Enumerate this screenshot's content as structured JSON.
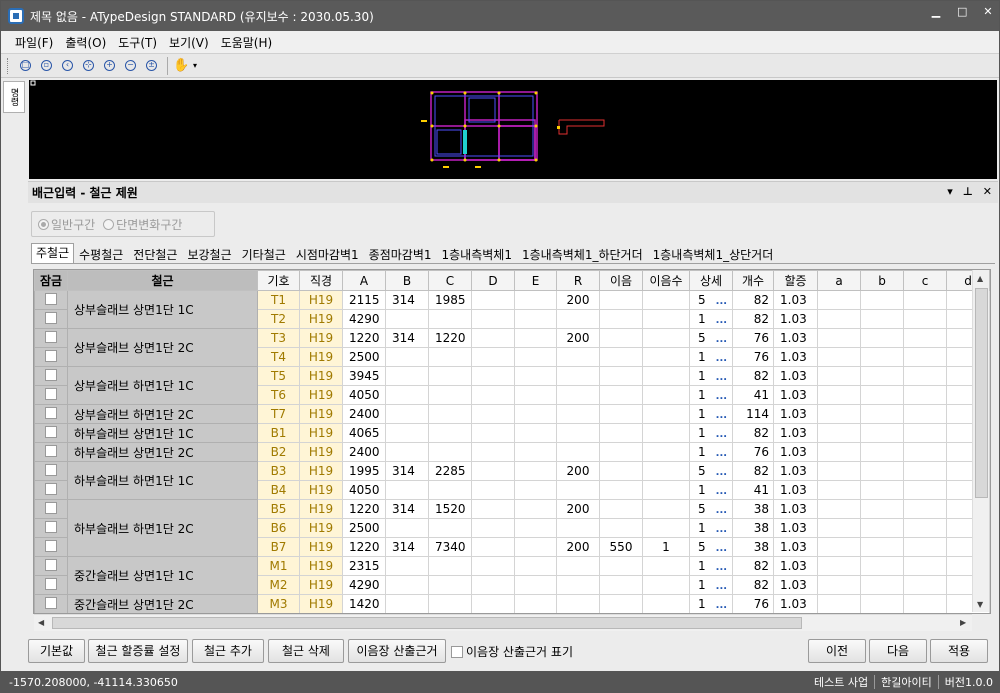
{
  "window": {
    "title": "제목 없음 - ATypeDesign STANDARD  (유지보수 : 2030.05.30)"
  },
  "menu": [
    "파일(F)",
    "출력(O)",
    "도구(T)",
    "보기(V)",
    "도움말(H)"
  ],
  "toolbar": {
    "icons": [
      "zoom-page-icon",
      "zoom-window-icon",
      "zoom-previous-icon",
      "zoom-extents-icon",
      "zoom-in-icon",
      "zoom-out-icon",
      "zoom-realtime-icon",
      "pan-hand-icon"
    ]
  },
  "sidetab": {
    "label": "명령"
  },
  "panel": {
    "title": "배근입력 - 철근 제원"
  },
  "radios": [
    {
      "label": "일반구간",
      "checked": true
    },
    {
      "label": "단면변화구간",
      "checked": false
    }
  ],
  "tabs": [
    "주철근",
    "수평철근",
    "전단철근",
    "보강철근",
    "기타철근",
    "시점마감벽1",
    "종점마감벽1",
    "1층내측벽체1",
    "1층내측벽체1_하단거더",
    "1층내측벽체1_상단거더"
  ],
  "columns": [
    "잠금",
    "철근",
    "기호",
    "직경",
    "A",
    "B",
    "C",
    "D",
    "E",
    "R",
    "이음",
    "이음수",
    "상세",
    "개수",
    "할증",
    "a",
    "b",
    "c",
    "d"
  ],
  "groups": [
    {
      "name": "상부슬래브 상면1단 1C",
      "rows": [
        {
          "sym": "T1",
          "dia": "H19",
          "A": "2115",
          "B": "314",
          "C": "1985",
          "R": "200",
          "joint": "",
          "jcount": "",
          "detail": "5",
          "count": "82",
          "rate": "1.03"
        },
        {
          "sym": "T2",
          "dia": "H19",
          "A": "4290",
          "B": "",
          "C": "",
          "R": "",
          "joint": "",
          "jcount": "",
          "detail": "1",
          "count": "82",
          "rate": "1.03"
        }
      ]
    },
    {
      "name": "상부슬래브 상면1단 2C",
      "rows": [
        {
          "sym": "T3",
          "dia": "H19",
          "A": "1220",
          "B": "314",
          "C": "1220",
          "R": "200",
          "joint": "",
          "jcount": "",
          "detail": "5",
          "count": "76",
          "rate": "1.03"
        },
        {
          "sym": "T4",
          "dia": "H19",
          "A": "2500",
          "B": "",
          "C": "",
          "R": "",
          "joint": "",
          "jcount": "",
          "detail": "1",
          "count": "76",
          "rate": "1.03"
        }
      ]
    },
    {
      "name": "상부슬래브 하면1단 1C",
      "rows": [
        {
          "sym": "T5",
          "dia": "H19",
          "A": "3945",
          "B": "",
          "C": "",
          "R": "",
          "joint": "",
          "jcount": "",
          "detail": "1",
          "count": "82",
          "rate": "1.03"
        },
        {
          "sym": "T6",
          "dia": "H19",
          "A": "4050",
          "B": "",
          "C": "",
          "R": "",
          "joint": "",
          "jcount": "",
          "detail": "1",
          "count": "41",
          "rate": "1.03"
        }
      ]
    },
    {
      "name": "상부슬래브 하면1단 2C",
      "rows": [
        {
          "sym": "T7",
          "dia": "H19",
          "A": "2400",
          "B": "",
          "C": "",
          "R": "",
          "joint": "",
          "jcount": "",
          "detail": "1",
          "count": "114",
          "rate": "1.03"
        }
      ]
    },
    {
      "name": "하부슬래브 상면1단 1C",
      "rows": [
        {
          "sym": "B1",
          "dia": "H19",
          "A": "4065",
          "B": "",
          "C": "",
          "R": "",
          "joint": "",
          "jcount": "",
          "detail": "1",
          "count": "82",
          "rate": "1.03"
        }
      ]
    },
    {
      "name": "하부슬래브 상면1단 2C",
      "rows": [
        {
          "sym": "B2",
          "dia": "H19",
          "A": "2400",
          "B": "",
          "C": "",
          "R": "",
          "joint": "",
          "jcount": "",
          "detail": "1",
          "count": "76",
          "rate": "1.03"
        }
      ]
    },
    {
      "name": "하부슬래브 하면1단 1C",
      "rows": [
        {
          "sym": "B3",
          "dia": "H19",
          "A": "1995",
          "B": "314",
          "C": "2285",
          "R": "200",
          "joint": "",
          "jcount": "",
          "detail": "5",
          "count": "82",
          "rate": "1.03"
        },
        {
          "sym": "B4",
          "dia": "H19",
          "A": "4050",
          "B": "",
          "C": "",
          "R": "",
          "joint": "",
          "jcount": "",
          "detail": "1",
          "count": "41",
          "rate": "1.03"
        }
      ]
    },
    {
      "name": "하부슬래브 하면1단 2C",
      "rows": [
        {
          "sym": "B5",
          "dia": "H19",
          "A": "1220",
          "B": "314",
          "C": "1520",
          "R": "200",
          "joint": "",
          "jcount": "",
          "detail": "5",
          "count": "38",
          "rate": "1.03"
        },
        {
          "sym": "B6",
          "dia": "H19",
          "A": "2500",
          "B": "",
          "C": "",
          "R": "",
          "joint": "",
          "jcount": "",
          "detail": "1",
          "count": "38",
          "rate": "1.03"
        },
        {
          "sym": "B7",
          "dia": "H19",
          "A": "1220",
          "B": "314",
          "C": "7340",
          "R": "200",
          "joint": "550",
          "jcount": "1",
          "detail": "5",
          "count": "38",
          "rate": "1.03"
        }
      ]
    },
    {
      "name": "중간슬래브 상면1단 1C",
      "rows": [
        {
          "sym": "M1",
          "dia": "H19",
          "A": "2315",
          "B": "",
          "C": "",
          "R": "",
          "joint": "",
          "jcount": "",
          "detail": "1",
          "count": "82",
          "rate": "1.03"
        },
        {
          "sym": "M2",
          "dia": "H19",
          "A": "4290",
          "B": "",
          "C": "",
          "R": "",
          "joint": "",
          "jcount": "",
          "detail": "1",
          "count": "82",
          "rate": "1.03"
        }
      ]
    },
    {
      "name": "중간슬래브 상면1단 2C",
      "rows": [
        {
          "sym": "M3",
          "dia": "H19",
          "A": "1420",
          "B": "",
          "C": "",
          "R": "",
          "joint": "",
          "jcount": "",
          "detail": "1",
          "count": "76",
          "rate": "1.03"
        }
      ]
    }
  ],
  "detail_more": "...",
  "buttons": {
    "default": "기본값",
    "rate_setting": "철근 할증률 설정",
    "add": "철근 추가",
    "delete": "철근 삭제",
    "lap_calc": "이음장 산출근거",
    "lap_show": "이음장 산출근거 표기",
    "prev": "이전",
    "next": "다음",
    "apply": "적용"
  },
  "status": {
    "coords": "-1570.208000, -41114.330650",
    "items": [
      "테스트 사업",
      "한길아이티",
      "버전1.0.0"
    ]
  }
}
